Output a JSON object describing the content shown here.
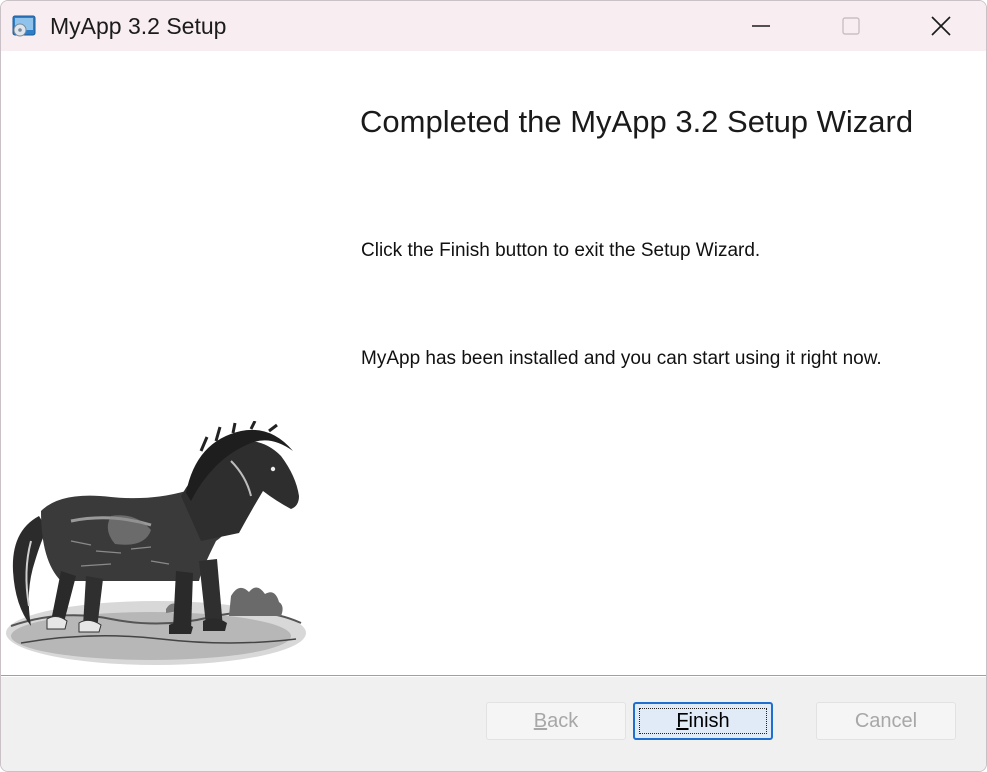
{
  "window": {
    "title": "MyApp 3.2 Setup",
    "controls": {
      "minimize_icon": "minimize-icon",
      "maximize_icon": "maximize-icon",
      "close_icon": "close-icon"
    }
  },
  "main": {
    "heading": "Completed the MyApp 3.2 Setup Wizard",
    "instruction": "Click the Finish button to exit the Setup Wizard.",
    "status_message": "MyApp has been installed and you can start using it right now.",
    "side_image": "horse-illustration"
  },
  "footer": {
    "back": {
      "mnemonic": "B",
      "rest": "ack",
      "enabled": false
    },
    "finish": {
      "mnemonic": "F",
      "rest": "inish",
      "enabled": true,
      "focused": true
    },
    "cancel": {
      "label": "Cancel",
      "enabled": false
    }
  },
  "colors": {
    "titlebar_bg": "#f8eef1",
    "footer_bg": "#f0f0f0",
    "focus_accent": "#1f6fd0",
    "disabled_text": "#a7a7a7"
  }
}
